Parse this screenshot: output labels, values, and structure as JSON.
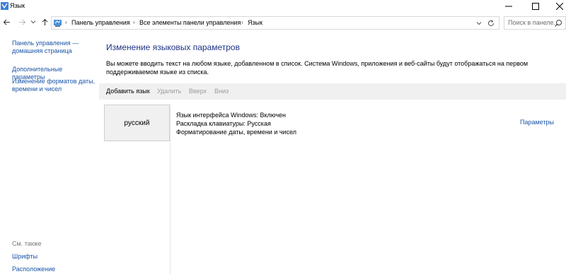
{
  "window": {
    "title": "Язык",
    "minimize_icon": "minimize-icon",
    "maximize_icon": "maximize-icon",
    "close_icon": "close-icon"
  },
  "navigation": {
    "breadcrumbs": [
      "Панель управления",
      "Все элементы панели управления",
      "Язык"
    ],
    "search_placeholder": "Поиск в панелe..."
  },
  "sidebar": {
    "home_link": "Панель управления — домашняя страница",
    "advanced_link": "Дополнительные параметры",
    "formats_link": "Изменение форматов даты, времени и чисел",
    "see_also_label": "См. также",
    "fonts_link": "Шрифты",
    "location_link": "Расположение"
  },
  "main": {
    "title": "Изменение языковых параметров",
    "description": "Вы можете вводить текст на любом языке, добавленном в список. Система Windows, приложения и веб-сайты будут отображаться на первом поддерживаемом языке из списка.",
    "toolbar": {
      "add": "Добавить язык",
      "remove": "Удалить",
      "up": "Вверх",
      "down": "Вниз"
    },
    "languages": [
      {
        "name": "русский",
        "details": [
          "Язык интерфейса Windows: Включен",
          "Раскладка клавиатуры: Русская",
          "Форматирование даты, времени и чисел"
        ],
        "options_link": "Параметры"
      }
    ]
  },
  "colors": {
    "link": "#1a55a8",
    "heading": "#1e3287",
    "toolbar_bg": "#f0f0f0",
    "disabled_text": "#9b9b9b"
  }
}
